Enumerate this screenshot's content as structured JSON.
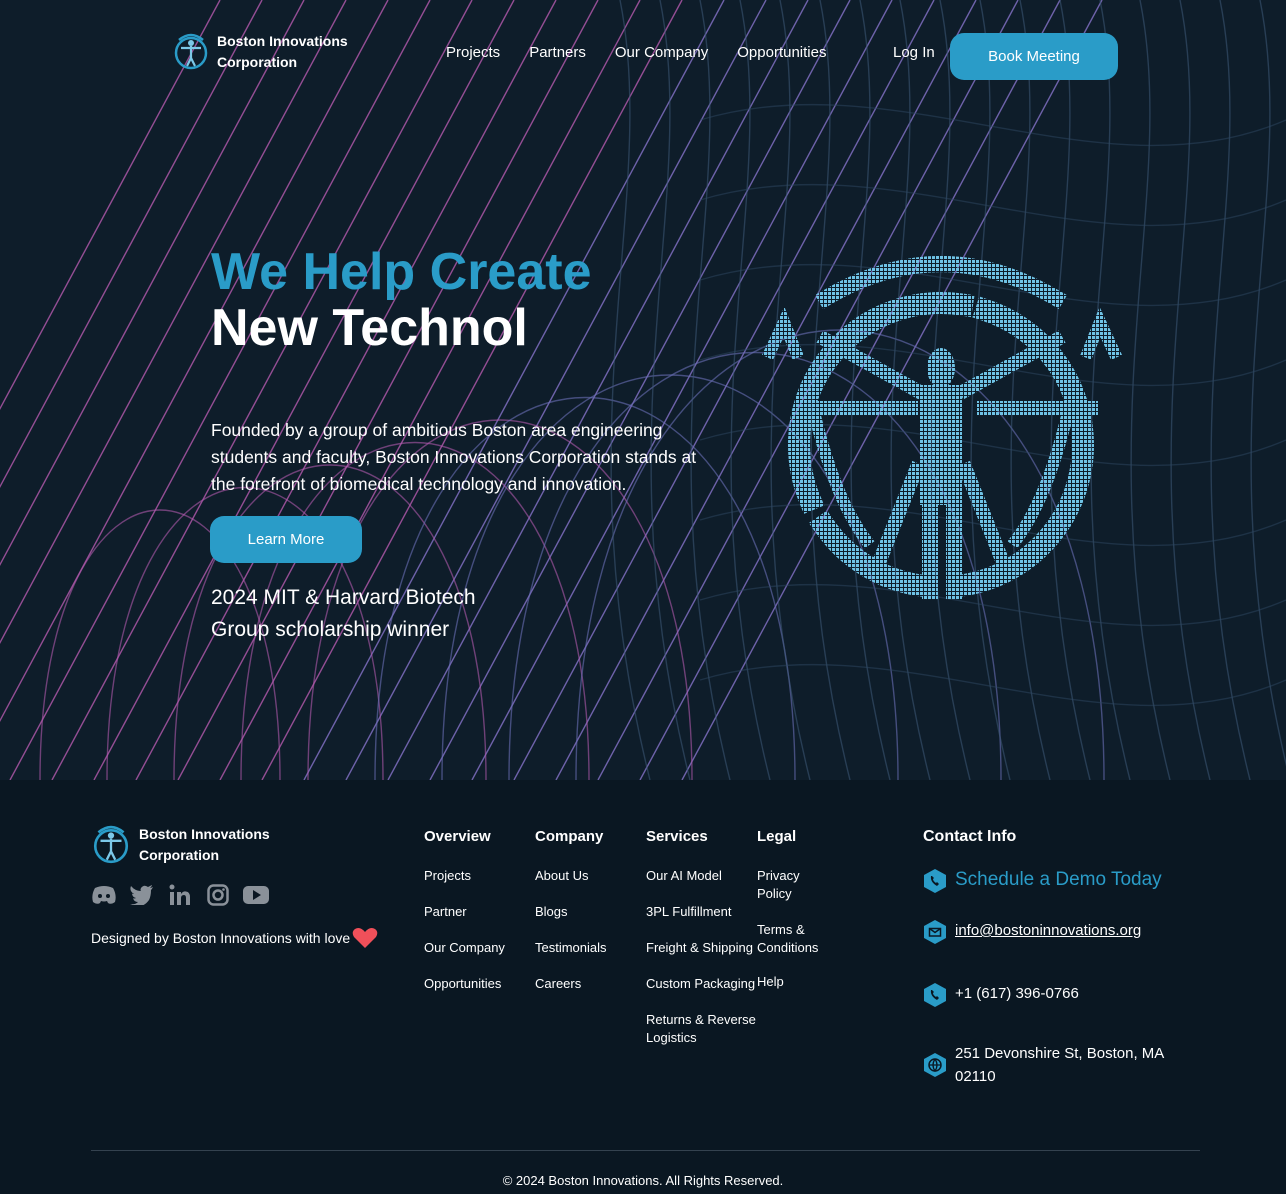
{
  "brand": {
    "name": "Boston Innovations\nCorporation",
    "accent": "#2a9cc8",
    "background": "#0a1722"
  },
  "nav": {
    "items": [
      "Projects",
      "Partners",
      "Our Company",
      "Opportunities"
    ],
    "login": "Log In",
    "cta": "Book Meeting"
  },
  "hero": {
    "headline_blue": "We Help Create",
    "headline_white": "New Technol",
    "description": "Founded by a group of ambitious Boston area engineering students and faculty, Boston Innovations Corporation stands at the forefront of biomedical technology and innovation.",
    "cta": "Learn More",
    "award": "2024 MIT & Harvard Biotech Group scholarship winner",
    "illustration": "vitruvian-man-icon"
  },
  "footer": {
    "brand": "Boston Innovations\nCorporation",
    "socials": [
      "discord-icon",
      "twitter-icon",
      "linkedin-icon",
      "instagram-icon",
      "youtube-icon"
    ],
    "designed_by": "Designed by Boston Innovations with love",
    "columns": [
      {
        "title": "Overview",
        "links": [
          "Projects",
          "Partner",
          "Our Company",
          "Opportunities"
        ]
      },
      {
        "title": "Company",
        "links": [
          "About Us",
          "Blogs",
          "Testimonials",
          "Careers"
        ]
      },
      {
        "title": "Services",
        "links": [
          "Our AI Model",
          "3PL Fulfillment",
          "Freight & Shipping",
          "Custom Packaging",
          "Returns & Reverse Logistics"
        ]
      },
      {
        "title": "Legal",
        "links": [
          "Privacy Policy",
          "Terms & Conditions",
          "Help"
        ]
      }
    ],
    "contact": {
      "title": "Contact Info",
      "demo": "Schedule a Demo Today",
      "email": "info@bostoninnovations.org",
      "phone": "+1 (617) 396-0766",
      "address": "251 Devonshire St, Boston, MA 02110"
    },
    "copyright": "© 2024 Boston Innovations. All Rights Reserved."
  }
}
